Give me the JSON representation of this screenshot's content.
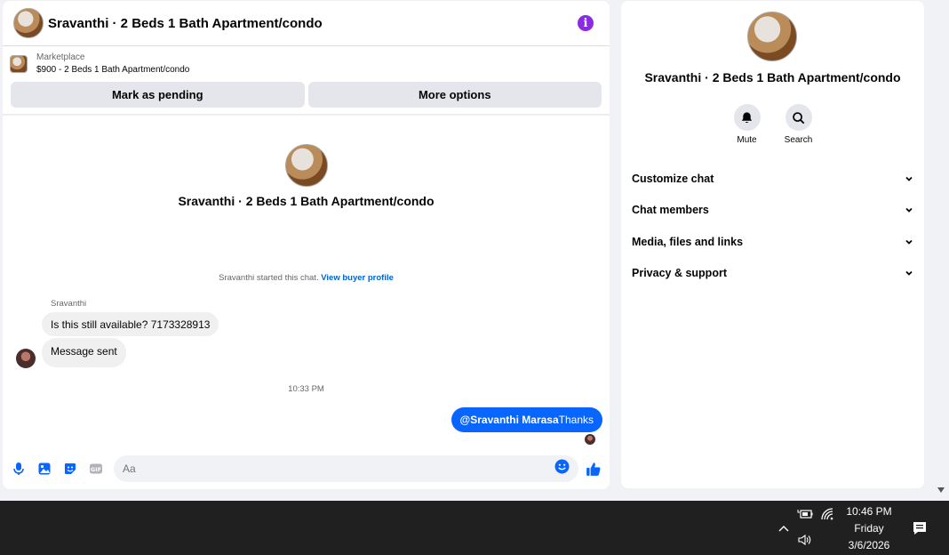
{
  "chat": {
    "title": "Sravanthi · 2 Beds 1 Bath Apartment/condo",
    "info_icon": "i",
    "listing_label": "Marketplace",
    "listing_detail": "$900 - 2 Beds 1 Bath Apartment/condo",
    "buttons": {
      "pending": "Mark as pending",
      "more": "More options"
    },
    "profile_name": "Sravanthi · 2 Beds 1 Bath Apartment/condo",
    "started_text": "Sravanthi started this chat.",
    "buyer_profile_link": "View buyer profile",
    "sender_name": "Sravanthi",
    "messages_in": [
      "Is this still available? 7173328913",
      "Message sent"
    ],
    "timestamp": "10:33 PM",
    "message_out": {
      "mention": "@Sravanthi Marasa",
      "text": "Thanks"
    },
    "composer_placeholder": "Aa",
    "accent_color": "#0866ff"
  },
  "info_panel": {
    "name": "Sravanthi · 2 Beds 1 Bath Apartment/condo",
    "actions": [
      {
        "label": "Mute",
        "icon": "bell-icon"
      },
      {
        "label": "Search",
        "icon": "search-icon"
      }
    ],
    "sections": [
      "Customize chat",
      "Chat members",
      "Media, files and links",
      "Privacy & support"
    ]
  },
  "taskbar": {
    "time": "10:46 PM",
    "day": "Friday",
    "date": "3/6/2026"
  }
}
